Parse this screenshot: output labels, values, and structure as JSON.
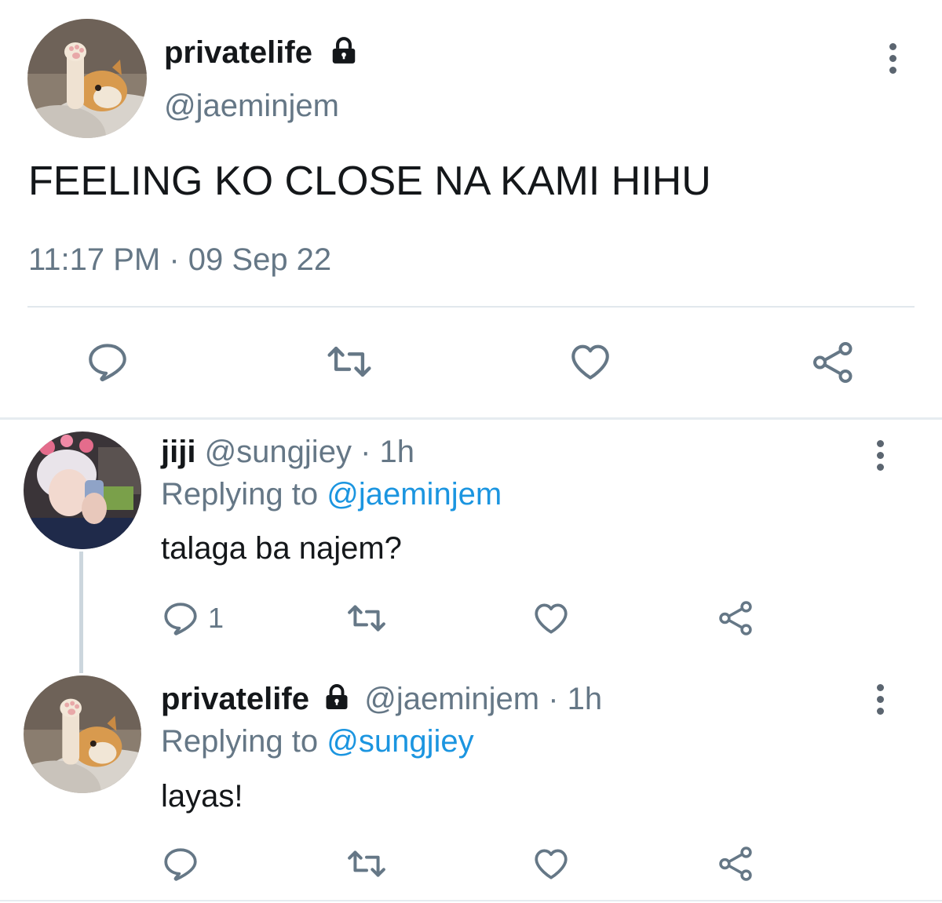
{
  "main_tweet": {
    "display_name": "privatelife",
    "handle": "@jaeminjem",
    "text": "FEELING KO CLOSE NA KAMI HIHU",
    "timestamp": "11:17 PM · 09 Sep 22",
    "avatar_icon": "cat-paw-avatar",
    "lock_icon": "lock-icon"
  },
  "replies": [
    {
      "display_name": "jiji",
      "handle": "@sungjiey",
      "time": "· 1h",
      "replying_prefix": "Replying to",
      "replying_to": "@jaeminjem",
      "text": "talaga ba najem?",
      "reply_count": "1",
      "avatar_icon": "person-avatar"
    },
    {
      "display_name": "privatelife",
      "handle": "@jaeminjem",
      "time": "· 1h",
      "replying_prefix": "Replying to",
      "replying_to": "@sungjiey",
      "text": "layas!",
      "reply_count": "",
      "avatar_icon": "cat-paw-avatar"
    }
  ],
  "colors": {
    "text": "#14171a",
    "muted": "#657786",
    "link": "#1b95e0",
    "divider": "#e1e8ed"
  }
}
